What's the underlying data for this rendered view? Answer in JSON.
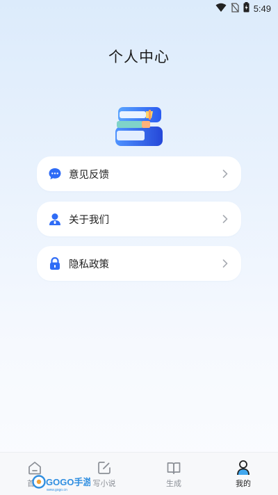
{
  "status_bar": {
    "time": "5:49",
    "icons": [
      "wifi-icon",
      "no-sim-icon",
      "battery-charging-icon"
    ]
  },
  "page": {
    "title": "个人中心"
  },
  "menu": [
    {
      "label": "意见反馈",
      "icon": "chat-bubble-icon"
    },
    {
      "label": "关于我们",
      "icon": "user-icon"
    },
    {
      "label": "隐私政策",
      "icon": "lock-icon"
    }
  ],
  "tabbar": {
    "tabs": [
      {
        "label": "首页",
        "icon": "home-icon",
        "active": false
      },
      {
        "label": "写小说",
        "icon": "edit-icon",
        "active": false
      },
      {
        "label": "生成",
        "icon": "book-icon",
        "active": false
      },
      {
        "label": "我的",
        "icon": "person-icon",
        "active": true
      }
    ]
  },
  "watermark": {
    "brand": "GOGO手游网",
    "url": "www.gogo.cn"
  },
  "colors": {
    "accent_blue": "#2f6cf6",
    "icon_blue": "#3b82f6",
    "tab_active_dot": "#41a7ee"
  }
}
